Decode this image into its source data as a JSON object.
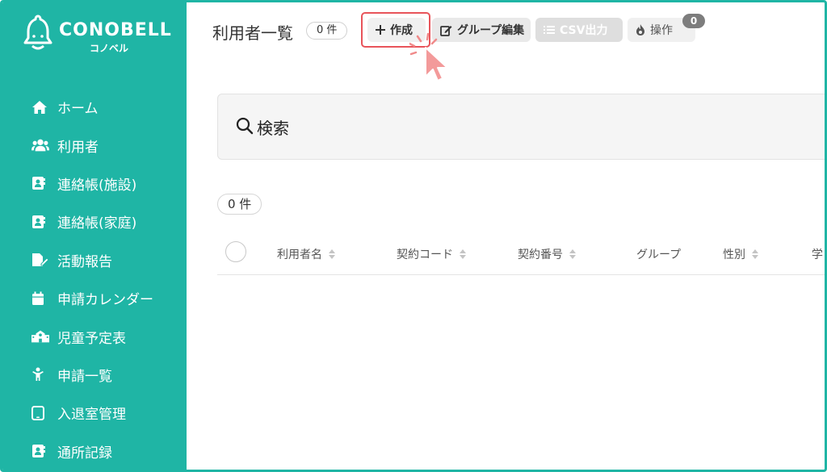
{
  "app": {
    "logo_text": "CONOBELL",
    "logo_sub": "コノベル"
  },
  "sidebar": {
    "items": [
      {
        "label": "ホーム",
        "icon": "home-icon"
      },
      {
        "label": "利用者",
        "icon": "users-icon"
      },
      {
        "label": "連絡帳(施設)",
        "icon": "contact-book-icon"
      },
      {
        "label": "連絡帳(家庭)",
        "icon": "contact-book-icon"
      },
      {
        "label": "活動報告",
        "icon": "report-edit-icon"
      },
      {
        "label": "申請カレンダー",
        "icon": "calendar-icon"
      },
      {
        "label": "児童予定表",
        "icon": "school-icon"
      },
      {
        "label": "申請一覧",
        "icon": "child-icon"
      },
      {
        "label": "入退室管理",
        "icon": "tablet-icon"
      },
      {
        "label": "通所記録",
        "icon": "contact-book-icon"
      }
    ]
  },
  "header": {
    "title": "利用者一覧",
    "count": "0 件",
    "create_label": "作成",
    "group_edit_label": "グループ編集",
    "csv_label": "CSV出力",
    "ops_label": "操作",
    "ops_badge": "0"
  },
  "search": {
    "label": "検索"
  },
  "results": {
    "count": "0 件"
  },
  "table": {
    "columns": [
      "利用者名",
      "契約コード",
      "契約番号",
      "グループ",
      "性別",
      "学"
    ]
  },
  "colors": {
    "brand": "#1fb5a5",
    "highlight": "#e8545a"
  }
}
